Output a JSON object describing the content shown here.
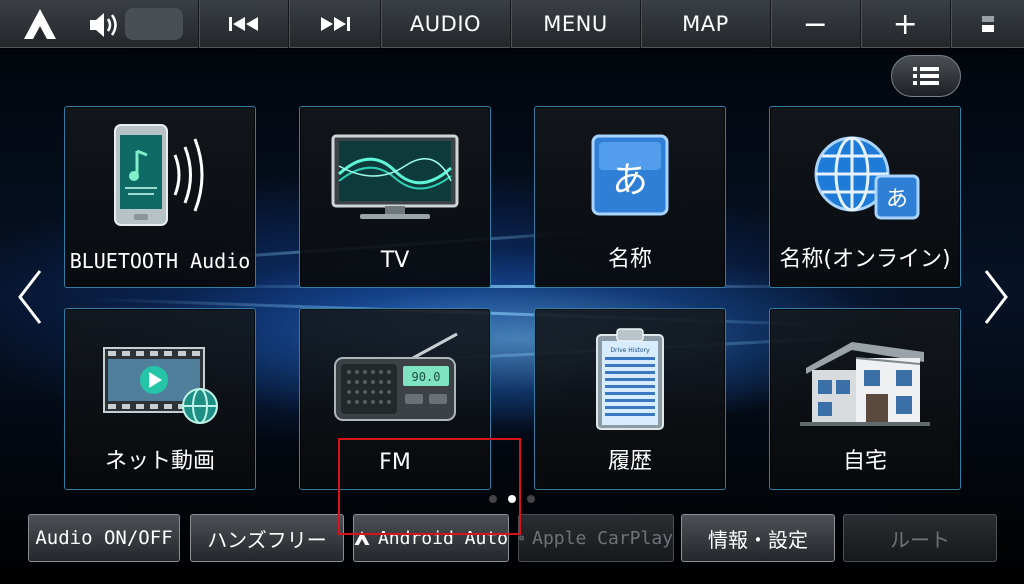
{
  "topbar": {
    "prev_icon": "skip-previous-icon",
    "next_icon": "skip-next-icon",
    "audio_label": "AUDIO",
    "menu_label": "MENU",
    "map_label": "MAP",
    "zoom_out_label": "−",
    "zoom_in_label": "+"
  },
  "tiles": [
    {
      "label": "BLUETOOTH Audio",
      "icon": "bluetooth-phone-icon"
    },
    {
      "label": "TV",
      "icon": "tv-icon"
    },
    {
      "label": "名称",
      "icon": "name-search-icon"
    },
    {
      "label": "名称(オンライン)",
      "icon": "online-name-search-icon"
    },
    {
      "label": "ネット動画",
      "icon": "net-video-icon"
    },
    {
      "label": "FM",
      "icon": "radio-icon"
    },
    {
      "label": "履歴",
      "icon": "history-clipboard-icon"
    },
    {
      "label": "自宅",
      "icon": "home-icon"
    }
  ],
  "clipboard_title": "Drive History",
  "radio_display": "90.0",
  "bottom": {
    "audio_onoff": "Audio ON/OFF",
    "handsfree": "ハンズフリー",
    "android_auto": "Android Auto",
    "apple_carplay": "Apple CarPlay",
    "info_settings": "情報・設定",
    "route": "ルート"
  },
  "pagination": {
    "pages": 3,
    "active": 2
  },
  "colors": {
    "highlight": "#d8141b",
    "tile_border": "#2f7fa6",
    "accent_blue": "#3aa0ff"
  }
}
